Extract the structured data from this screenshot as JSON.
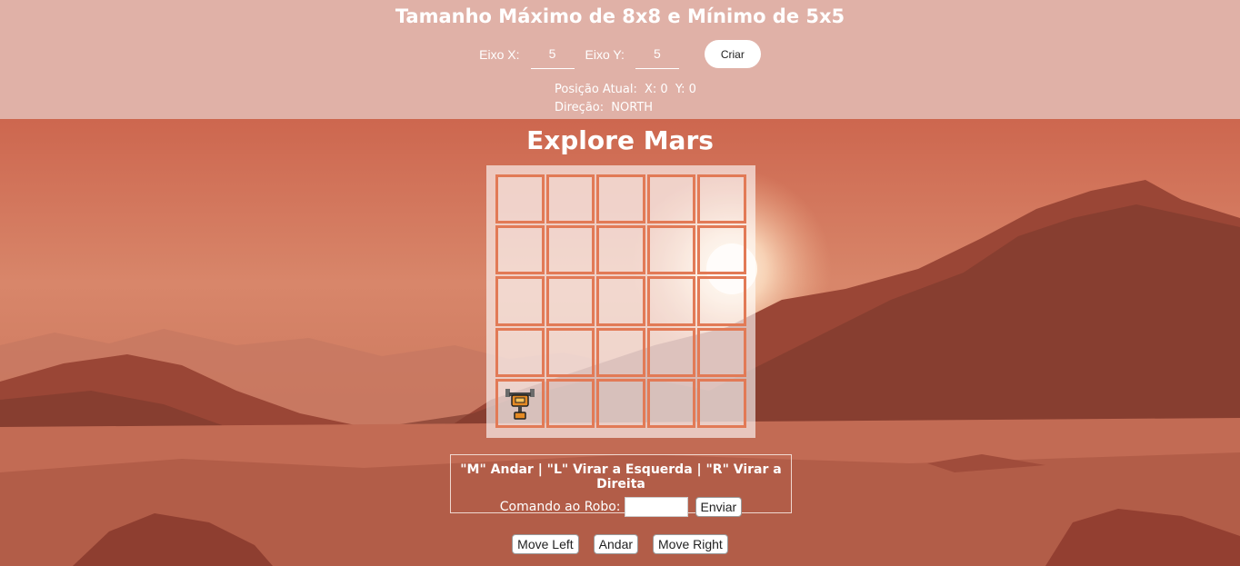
{
  "header": {
    "title": "Tamanho Máximo de 8x8 e Mínimo de 5x5",
    "x_label": "Eixo X:",
    "x_value": "5",
    "y_label": "Eixo Y:",
    "y_value": "5",
    "create_label": "Criar"
  },
  "status": {
    "position_label": "Posição Atual:",
    "x_text": "X: 0",
    "y_text": "Y: 0",
    "direction_label": "Direção:",
    "direction_value": "NORTH"
  },
  "main": {
    "title": "Explore Mars",
    "grid_size": 5,
    "robot": {
      "x": 0,
      "y": 0,
      "direction": "NORTH",
      "icon": "robot-icon"
    }
  },
  "commands": {
    "help": "\"M\" Andar | \"L\" Virar a Esquerda | \"R\" Virar a Direita",
    "input_label": "Comando ao Robo:",
    "input_value": "",
    "send_label": "Enviar"
  },
  "moves": {
    "left_label": "Move Left",
    "walk_label": "Andar",
    "right_label": "Move Right"
  },
  "colors": {
    "sky": "#c25a45",
    "header_bg": "#e0b1a7",
    "cell_border": "#e27a56"
  }
}
